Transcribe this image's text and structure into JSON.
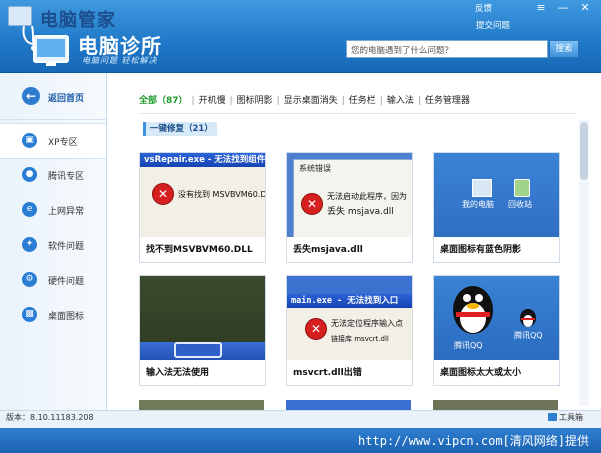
{
  "window": {
    "ghost_title": "电脑管家",
    "top_links": {
      "feedback": "反馈",
      "submit": "提交问题"
    },
    "controls": {
      "menu": "≡",
      "minimize": "—",
      "close": "✕"
    }
  },
  "header": {
    "title": "电脑诊所",
    "slogan": "电脑问题 轻松解决",
    "search_placeholder": "您的电脑遇到了什么问题？",
    "search_button": "搜索"
  },
  "sidebar": {
    "back_label": "返回首页",
    "items": [
      {
        "label": "XP专区",
        "icon": "windows-icon",
        "active": true
      },
      {
        "label": "腾讯专区",
        "icon": "tencent-icon",
        "active": false
      },
      {
        "label": "上网异常",
        "icon": "ie-icon",
        "active": false
      },
      {
        "label": "软件问题",
        "icon": "software-icon",
        "active": false
      },
      {
        "label": "硬件问题",
        "icon": "hardware-icon",
        "active": false
      },
      {
        "label": "桌面图标",
        "icon": "desktop-icon",
        "active": false
      }
    ]
  },
  "tabs": [
    "全部（87）",
    "开机慢",
    "图标阴影",
    "显示桌面消失",
    "任务栏",
    "输入法",
    "任务管理器"
  ],
  "section": {
    "label": "一键修复（21）"
  },
  "cards": [
    {
      "label": "找不到MSVBVM60.DLL",
      "window_title": "vsRepair.exe - 无法找到组件",
      "message": "没有找到 MSVBVM60.DLL"
    },
    {
      "label": "丢失msjava.dll",
      "window_title": "系统错误",
      "message_line1": "无法启动此程序，因为",
      "message_line2": "丢失 msjava.dll"
    },
    {
      "label": "桌面图标有蓝色阴影",
      "icon1": "我的电脑",
      "icon2": "回收站"
    },
    {
      "label": "输入法无法使用"
    },
    {
      "label": "msvcrt.dll出错",
      "window_title": "main.exe - 无法找到入口",
      "message_line1": "无法定位程序输入点",
      "message_line2": "链接库 msvcrt.dll"
    },
    {
      "label": "桌面图标太大或太小",
      "icon1": "腾讯QQ",
      "icon2": "腾讯QQ"
    }
  ],
  "footer": {
    "version": "版本：8.10.11183.208",
    "toolbox": "工具箱",
    "watermark": "http://www.vipcn.com[清风网络]提供"
  },
  "colors": {
    "brand_blue": "#1f78c8",
    "active_tab_green": "#1e9c2a",
    "error_red": "#d62020"
  }
}
